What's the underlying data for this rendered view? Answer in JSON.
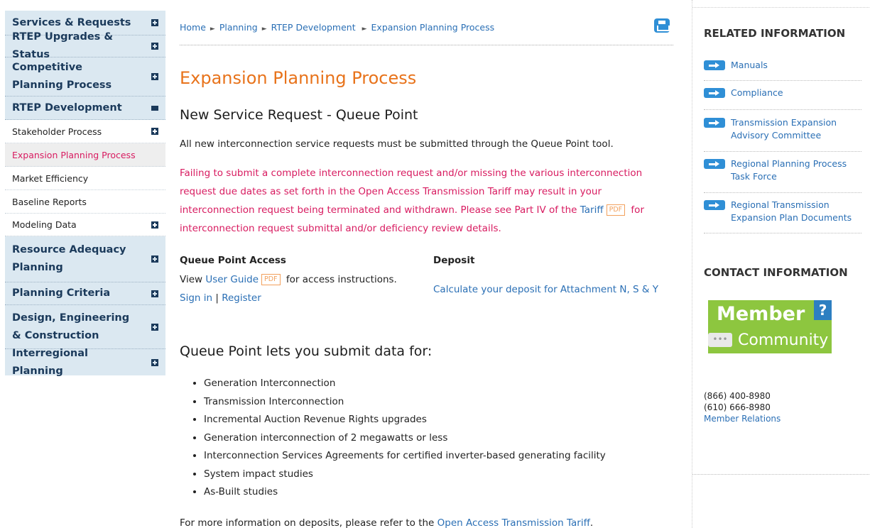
{
  "left_nav": {
    "items": [
      {
        "label": "Services & Requests",
        "level": "top",
        "icon": "plus-icon"
      },
      {
        "label": "RTEP Upgrades & Status",
        "level": "top",
        "icon": "plus-icon"
      },
      {
        "label": "Competitive Planning Process",
        "level": "top",
        "icon": "plus-icon"
      },
      {
        "label": "RTEP Development",
        "level": "top",
        "icon": "minus-icon"
      },
      {
        "label": "Stakeholder Process",
        "level": "sub",
        "icon": "plus-icon"
      },
      {
        "label": "Expansion Planning Process",
        "level": "sub",
        "active": true
      },
      {
        "label": "Market Efficiency",
        "level": "sub"
      },
      {
        "label": "Baseline Reports",
        "level": "sub"
      },
      {
        "label": "Modeling Data",
        "level": "sub",
        "icon": "plus-icon"
      },
      {
        "label": "Resource Adequacy Planning",
        "level": "top",
        "icon": "plus-icon"
      },
      {
        "label": "Planning Criteria",
        "level": "top",
        "icon": "plus-icon"
      },
      {
        "label": "Design, Engineering & Construction",
        "level": "top",
        "icon": "plus-icon"
      },
      {
        "label": "Interregional Planning",
        "level": "top",
        "icon": "plus-icon"
      }
    ]
  },
  "breadcrumb": [
    "Home",
    "Planning",
    "RTEP Development",
    "Expansion Planning Process"
  ],
  "breadcrumb_sep": "►",
  "page_title": "Expansion Planning Process",
  "section1_title": "New Service Request - Queue Point",
  "intro_text": "All new interconnection service requests must be submitted through the Queue Point tool.",
  "warning": {
    "text_before": "Failing to submit a complete interconnection request and/or missing the various interconnection request due dates as set forth in the Open Access Transmission Tariff may result in your interconnection request being terminated and withdrawn. Please see Part IV of the ",
    "link": "Tariff",
    "pdf": "PDF",
    "text_after": " for interconnection request submittal and/or deficiency review details."
  },
  "queue_access": {
    "heading": "Queue Point Access",
    "view": "View ",
    "guide_link": "User Guide",
    "pdf": "PDF",
    "suffix": " for access instructions.",
    "sign_in": "Sign in",
    "sep": " | ",
    "register": "Register"
  },
  "deposit": {
    "heading": "Deposit",
    "link": "Calculate your deposit for Attachment N, S & Y"
  },
  "section2_title": "Queue Point lets you submit data for:",
  "bullets": [
    "Generation Interconnection",
    "Transmission Interconnection",
    "Incremental Auction Revenue Rights upgrades",
    "Generation interconnection of 2 megawatts or less",
    "Interconnection Services Agreements for certified inverter-based generating facility",
    "System impact studies",
    "As-Built studies"
  ],
  "footer_text": "For more information on deposits, please refer to the ",
  "footer_link": "Open Access Transmission Tariff",
  "footer_end": ".",
  "related": {
    "heading": "RELATED INFORMATION",
    "links": [
      "Manuals",
      "Compliance",
      "Transmission Expansion Advisory Committee",
      "Regional Planning Process Task Force",
      "Regional Transmission Expansion Plan Documents"
    ]
  },
  "contact": {
    "heading": "CONTACT INFORMATION",
    "logo_top": "Member",
    "logo_q": "?",
    "logo_bottom": "Community",
    "logo_bubble": "•••",
    "phone1": "(866) 400-8980",
    "phone2": "(610) 666-8980",
    "link": "Member Relations"
  },
  "colors": {
    "accent_orange": "#e8731b",
    "warning_pink": "#d81b60",
    "link_blue": "#2a6fb5",
    "nav_bg": "#dbe8f1",
    "logo_green": "#8dc63f"
  }
}
